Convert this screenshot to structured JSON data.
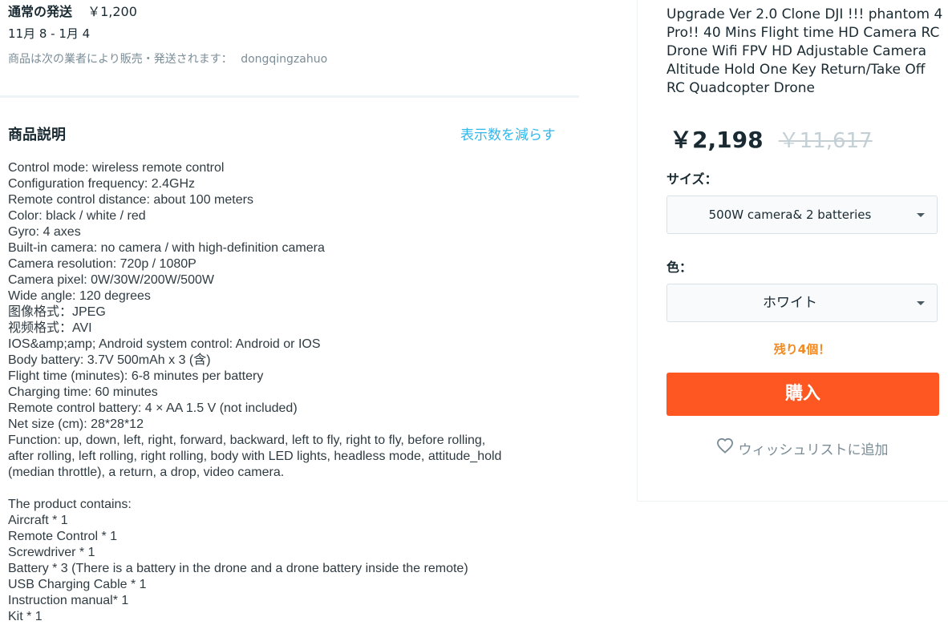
{
  "shipping": {
    "label": "通常の発送",
    "price": "￥1,200",
    "dates": "11月 8 - 1月 4",
    "seller_prefix": "商品は次の業者により販売・発送されます：",
    "seller_name": "dongqingzahuo"
  },
  "description": {
    "title": "商品説明",
    "show_less": "表示数を減らす",
    "lines": [
      "Control mode: wireless remote control",
      "Configuration frequency: 2.4GHz",
      "Remote control distance: about 100 meters",
      "Color: black / white / red",
      "Gyro: 4 axes",
      "Built-in camera: no camera / with high-definition camera",
      "Camera resolution: 720p / 1080P",
      "Camera pixel: 0W/30W/200W/500W",
      "Wide angle: 120 degrees",
      "图像格式：JPEG",
      "视频格式：AVI",
      "IOS&amp;amp; Android system control: Android or IOS",
      "Body battery: 3.7V 500mAh x 3 (含)",
      "Flight time (minutes): 6-8 minutes per battery",
      "Charging time: 60 minutes",
      "Remote control battery: 4 × AA 1.5 V (not included)",
      "Net size (cm): 28*28*12",
      "Function: up, down, left, right, forward, backward, left to fly, right to fly, before rolling,",
      "after rolling, left rolling, right rolling, body with LED lights, headless mode, attitude_hold",
      "(median throttle), a return, a drop, video camera.",
      "",
      "The product contains:",
      "Aircraft * 1",
      "Remote Control * 1",
      "Screwdriver * 1",
      "Battery * 3 (There is a battery in the drone and a drone battery inside the remote)",
      "USB Charging Cable * 1",
      "Instruction manual* 1",
      "Kit * 1"
    ]
  },
  "product": {
    "title": "Upgrade Ver 2.0 Clone DJI !!! phantom 4 Pro!! 40 Mins Flight time HD Camera RC Drone Wifi FPV HD Adjustable Camera Altitude Hold One Key Return/Take Off RC Quadcopter Drone",
    "price_now": "￥2,198",
    "price_old": "￥11,617",
    "size_label": "サイズ：",
    "size_value": "500W camera& 2 batteries",
    "color_label": "色：",
    "color_value": "ホワイト",
    "stock_text": "残り4個！",
    "buy_label": "購入",
    "wishlist_label": "ウィッシュリストに追加"
  },
  "colors": {
    "buy_button": "#ff5722",
    "link": "#2fb7ec",
    "stock": "#f08a24",
    "old_price": "#c5d0d6"
  },
  "icons": {
    "select_caret": "chevron-down-icon",
    "wishlist": "heart-icon"
  }
}
